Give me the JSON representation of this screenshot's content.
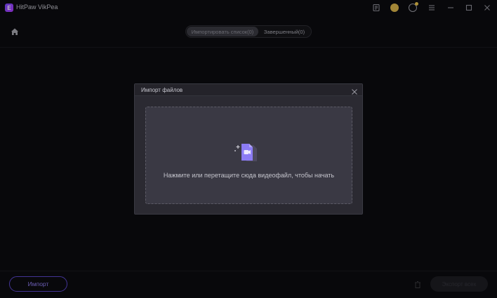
{
  "window": {
    "title": "HitPaw VikPea",
    "logo_letter": "E"
  },
  "titlebar_icons": [
    "news-icon",
    "coin-icon",
    "user-icon",
    "menu-icon",
    "minimize-icon",
    "maximize-icon",
    "close-icon"
  ],
  "tabs": [
    {
      "label": "Импортировать список(0)",
      "active": true
    },
    {
      "label": "Завершенный(0)",
      "active": false
    }
  ],
  "modal": {
    "title": "Импорт файлов",
    "drop_text": "Нажмите или перетащите сюда видеофайл, чтобы начать"
  },
  "footer": {
    "import_label": "Импорт",
    "export_label": "Экспорт всех"
  },
  "colors": {
    "accent": "#5a46c8",
    "accent_text": "#8f7df0",
    "drop_icon": "#8c7cf5",
    "background": "#0b0b0f",
    "modal_bg": "#2b2a32"
  }
}
